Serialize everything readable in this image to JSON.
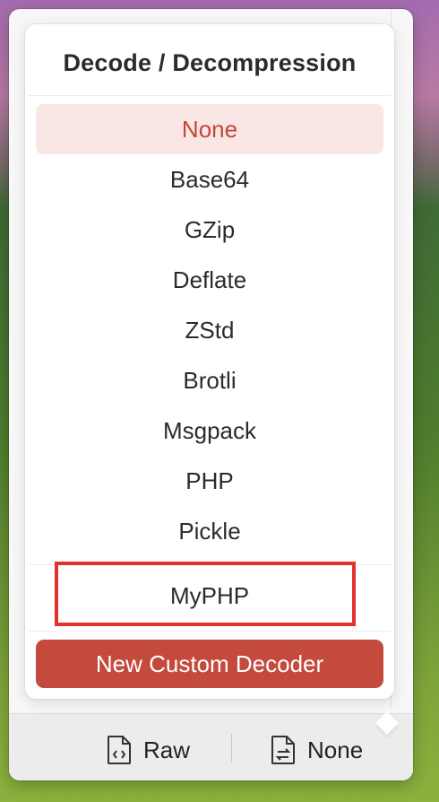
{
  "popover": {
    "title": "Decode / Decompression",
    "builtin_decoders": [
      {
        "label": "None",
        "selected": true
      },
      {
        "label": "Base64"
      },
      {
        "label": "GZip"
      },
      {
        "label": "Deflate"
      },
      {
        "label": "ZStd"
      },
      {
        "label": "Brotli"
      },
      {
        "label": "Msgpack"
      },
      {
        "label": "PHP"
      },
      {
        "label": "Pickle"
      }
    ],
    "custom_decoders": [
      {
        "label": "MyPHP"
      }
    ],
    "new_custom_button": "New Custom Decoder"
  },
  "status_bar": {
    "raw_label": "Raw",
    "decoder_label": "None"
  },
  "colors": {
    "accent": "#c54a3e",
    "selected_bg": "#f9e7e5",
    "selected_text": "#c4463a",
    "highlight_border": "#e4322b"
  }
}
